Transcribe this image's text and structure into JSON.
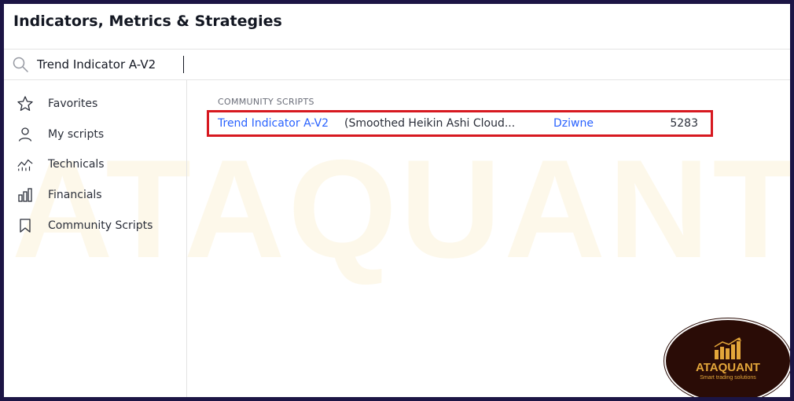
{
  "dialog": {
    "title": "Indicators, Metrics & Strategies"
  },
  "search": {
    "value": "Trend Indicator A-V2",
    "icon": "search-icon"
  },
  "sidebar": {
    "items": [
      {
        "label": "Favorites",
        "icon": "star-icon"
      },
      {
        "label": "My scripts",
        "icon": "user-icon"
      },
      {
        "label": "Technicals",
        "icon": "chart-line-icon"
      },
      {
        "label": "Financials",
        "icon": "bar-chart-icon"
      },
      {
        "label": "Community Scripts",
        "icon": "bookmark-icon"
      }
    ]
  },
  "main": {
    "section_label": "COMMUNITY SCRIPTS",
    "results": [
      {
        "name": "Trend Indicator A-V2",
        "description": "(Smoothed Heikin Ashi Cloud...",
        "author": "Dziwne",
        "count": "5283"
      }
    ]
  },
  "watermark": "ATAQUANT",
  "badge": {
    "brand": "ATAQUANT",
    "tagline": "Smart trading solutions"
  },
  "colors": {
    "outer_frame": "#1c1545",
    "link": "#2962ff",
    "highlight_border": "#d71920",
    "badge_bg": "#2a0c06",
    "badge_gold": "#e3a63a"
  }
}
